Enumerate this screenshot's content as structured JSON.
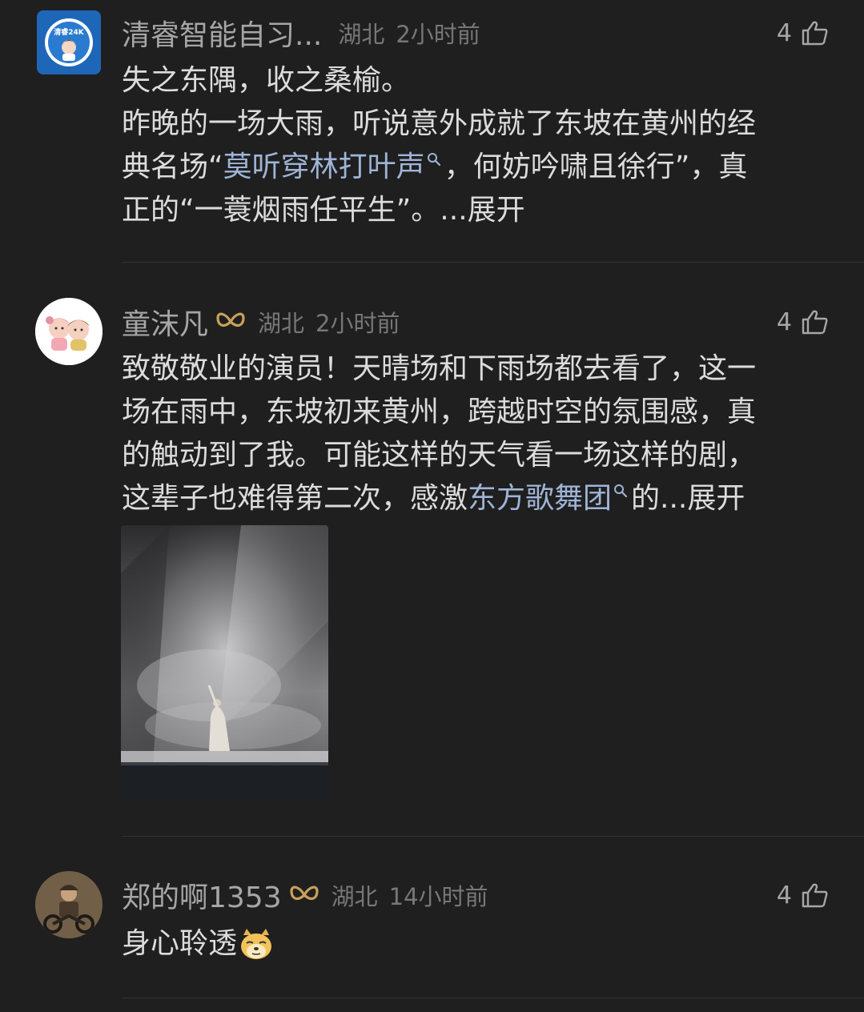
{
  "comments": [
    {
      "username": "清睿智能自习...",
      "location": "湖北",
      "time": "2小时前",
      "likes": "4",
      "avatar_text": "清睿24K",
      "lines": [
        "失之东隅，收之桑榆。",
        "昨晚的一场大雨，听说意外成就了东坡在黄州的经",
        "典名场",
        "“",
        "莫听穿林打叶声",
        "，何妨吟啸且徐行”，真",
        "正的“一蓑烟雨任平生”。...",
        "展开"
      ]
    },
    {
      "username": "童沫凡",
      "location": "湖北",
      "time": "2小时前",
      "likes": "4",
      "lines": [
        "致敬敬业的演员！天晴场和下雨场都去看了，这一",
        "场在雨中，东坡初来黄州，跨越时空的氛围感，真",
        "的触动到了我。可能这样的天气看一场这样的剧，",
        "这辈子也难得第二次，感激",
        "东方歌舞团",
        "的...",
        "展开"
      ]
    },
    {
      "username": "郑的啊1353",
      "location": "湖北",
      "time": "14小时前",
      "likes": "4",
      "text": "身心聆透"
    }
  ],
  "colors": {
    "background": "#1f1f1f",
    "link": "#9fb4d6",
    "badge": "#c9a15a"
  }
}
